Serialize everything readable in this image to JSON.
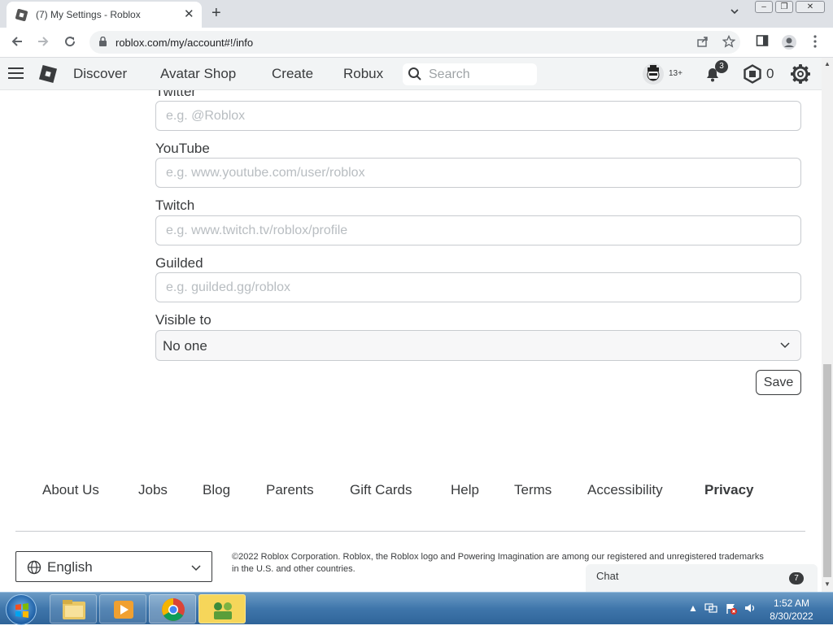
{
  "browser": {
    "tab_title": "(7) My Settings - Roblox",
    "tab_close": "✕",
    "new_tab": "+",
    "url": "roblox.com/my/account#!/info",
    "window_buttons": [
      "–",
      "❐",
      "✕"
    ]
  },
  "header": {
    "nav": [
      "Discover",
      "Avatar Shop",
      "Create",
      "Robux"
    ],
    "search_placeholder": "Search",
    "age_label": "13+",
    "notifications_count": "3",
    "robux_count": "0"
  },
  "form": {
    "twitter": {
      "label": "Twitter",
      "placeholder": "e.g. @Roblox"
    },
    "youtube": {
      "label": "YouTube",
      "placeholder": "e.g. www.youtube.com/user/roblox"
    },
    "twitch": {
      "label": "Twitch",
      "placeholder": "e.g. www.twitch.tv/roblox/profile"
    },
    "guilded": {
      "label": "Guilded",
      "placeholder": "e.g. guilded.gg/roblox"
    },
    "visible_to": {
      "label": "Visible to",
      "value": "No one"
    },
    "save_label": "Save"
  },
  "footer": {
    "links": [
      "About Us",
      "Jobs",
      "Blog",
      "Parents",
      "Gift Cards",
      "Help",
      "Terms",
      "Accessibility",
      "Privacy"
    ],
    "language": "English",
    "copyright": "©2022 Roblox Corporation. Roblox, the Roblox logo and Powering Imagination are among our registered and unregistered trademarks in the U.S. and other countries."
  },
  "chat": {
    "label": "Chat",
    "count": "7"
  },
  "taskbar": {
    "time": "1:52 AM",
    "date": "8/30/2022"
  },
  "colors": {
    "text": "#393b3d",
    "header_bg": "#f2f4f5",
    "taskbar": "#3f76ab"
  }
}
